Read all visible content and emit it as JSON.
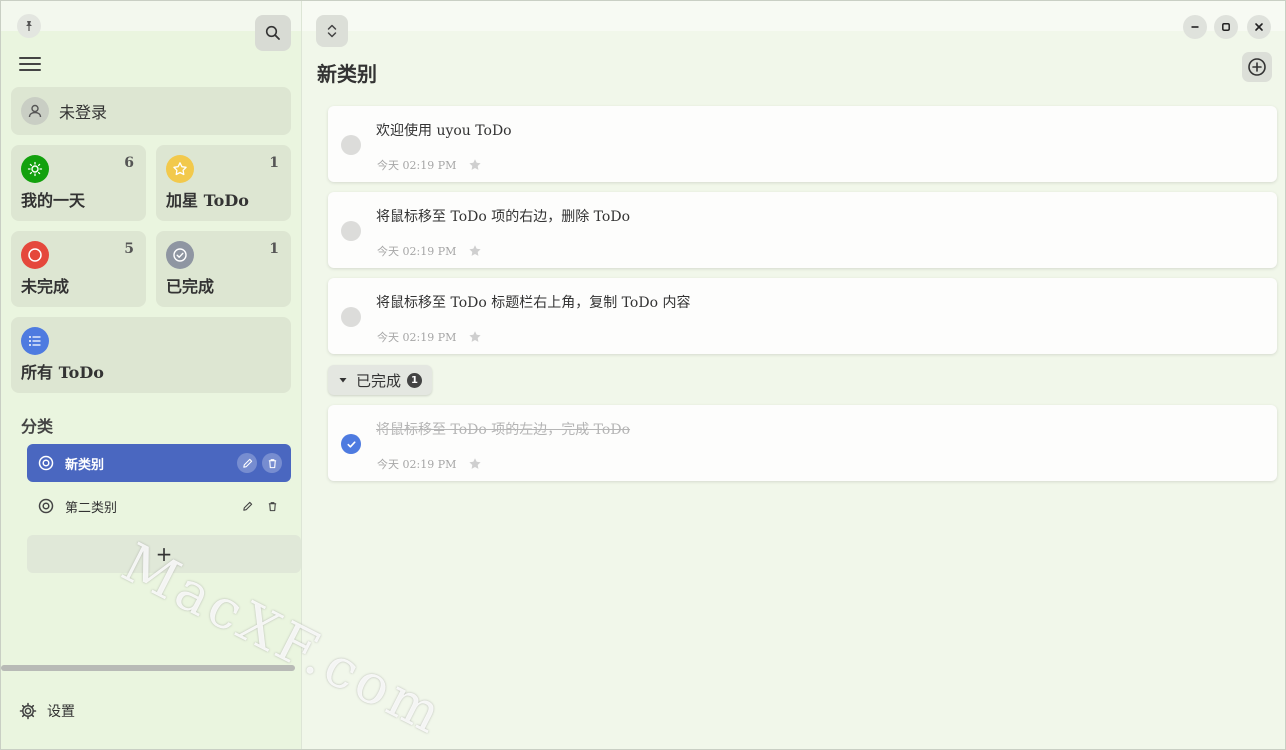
{
  "sidebar": {
    "login_label": "未登录",
    "tiles": [
      {
        "label": "我的一天",
        "count": "6",
        "icon": "sun-icon",
        "color": "#13a10e"
      },
      {
        "label": "加星 ToDo",
        "count": "1",
        "icon": "star-icon",
        "color": "#f2c94c"
      },
      {
        "label": "未完成",
        "count": "5",
        "icon": "circle-icon",
        "color": "#e5483c"
      },
      {
        "label": "已完成",
        "count": "1",
        "icon": "check-circle-icon",
        "color": "#8f96a2"
      }
    ],
    "all_label": "所有 ToDo",
    "all_color": "#4e7be0",
    "categories_heading": "分类",
    "categories": [
      {
        "label": "新类别",
        "active": true
      },
      {
        "label": "第二类别",
        "active": false
      }
    ],
    "add_category_symbol": "+",
    "settings_label": "设置"
  },
  "main": {
    "title": "新类别",
    "todos": [
      {
        "title": "欢迎使用 uyou ToDo",
        "time": "今天 02:19 PM",
        "done": false
      },
      {
        "title": "将鼠标移至 ToDo 项的右边，删除 ToDo",
        "time": "今天 02:19 PM",
        "done": false
      },
      {
        "title": "将鼠标移至 ToDo 标题栏右上角，复制 ToDo 内容",
        "time": "今天 02:19 PM",
        "done": false
      }
    ],
    "completed_label": "已完成",
    "completed_count": "1",
    "completed_todos": [
      {
        "title": "将鼠标移至 ToDo 项的左边，完成 ToDo",
        "time": "今天 02:19 PM",
        "done": true
      }
    ]
  },
  "watermark": "MacXF.com",
  "colors": {
    "accent": "#4a67c0",
    "check_done": "#4e7be0"
  }
}
